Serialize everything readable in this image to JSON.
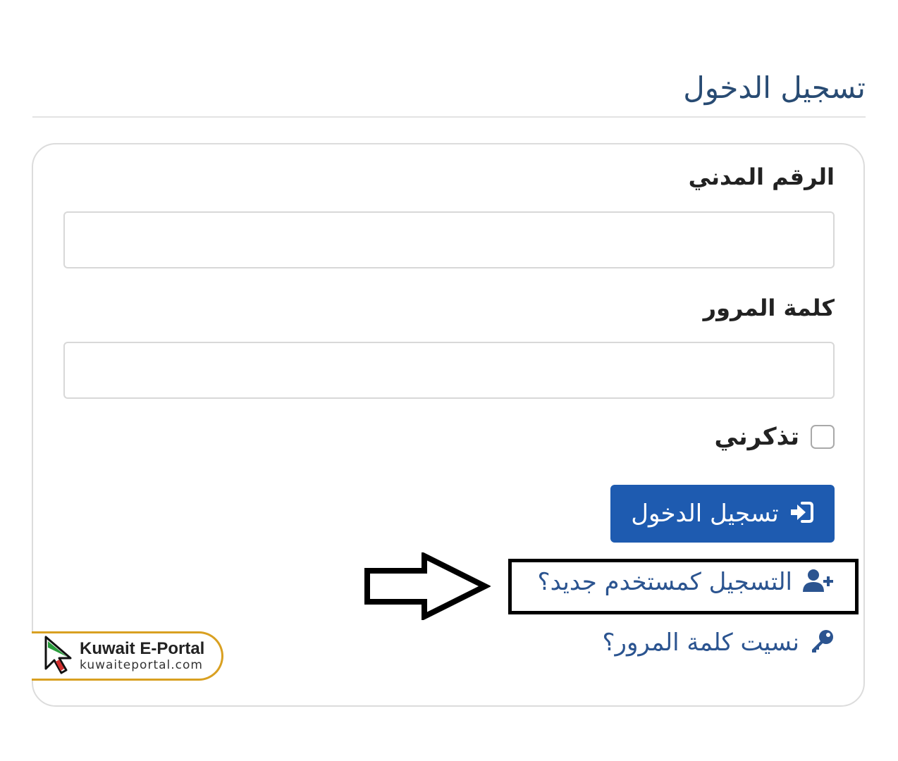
{
  "page": {
    "title": "تسجيل الدخول"
  },
  "form": {
    "civil_id_label": "الرقم المدني",
    "civil_id_value": "",
    "password_label": "كلمة المرور",
    "password_value": "",
    "remember_label": "تذكرني",
    "remember_checked": false,
    "login_button_label": "تسجيل الدخول",
    "login_button_icon": "sign-in-icon",
    "accent_color": "#1e5bb0"
  },
  "links": {
    "register_label": "التسجيل كمستخدم جديد؟",
    "register_icon": "user-plus-icon",
    "forgot_label": "نسيت كلمة المرور؟",
    "forgot_icon": "key-icon",
    "link_color": "#2b5490"
  },
  "annotation": {
    "arrow_icon": "right-arrow-icon",
    "highlight_box": "register-highlight"
  },
  "badge": {
    "title": "Kuwait E-Portal",
    "subtitle": "kuwaiteportal.com",
    "border_color": "#d9a021"
  }
}
